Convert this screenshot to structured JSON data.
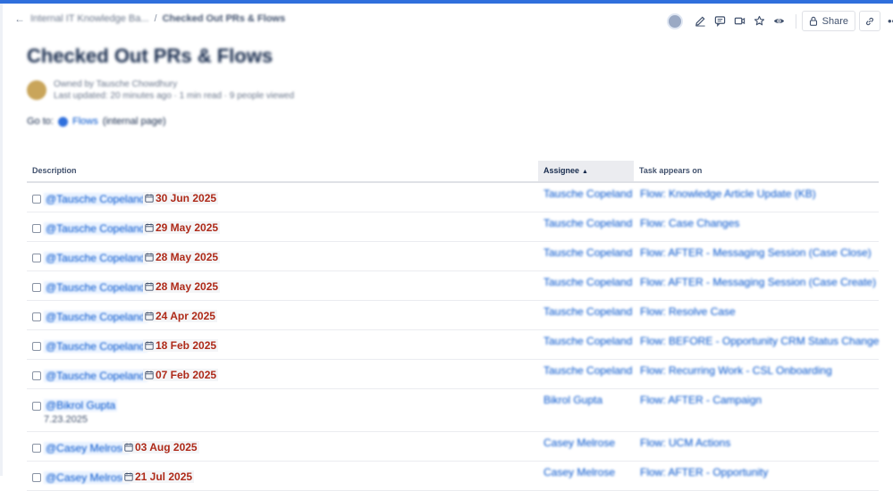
{
  "header": {
    "breadcrumbs": [
      "Internal IT Knowledge Ba..."
    ],
    "current_page": "Checked Out PRs & Flows",
    "share_label": "Share"
  },
  "page": {
    "title": "Checked Out PRs & Flows",
    "owner_line": "Owned by Tausche Chowdhury",
    "meta_line": "Last updated: 20 minutes ago · 1 min read · 9 people viewed",
    "goto_prefix": "Go to:",
    "goto_link": "Flows",
    "goto_suffix": "(internal page)"
  },
  "table": {
    "headers": {
      "description": "Description",
      "assignee": "Assignee",
      "task": "Task appears on"
    },
    "rows": [
      {
        "mention": "@Tausche Copeland",
        "date": "30 Jun 2025",
        "assignee": "Tausche Copeland",
        "task": "Flow: Knowledge Article Update (KB)"
      },
      {
        "mention": "@Tausche Copeland",
        "date": "29 May 2025",
        "assignee": "Tausche Copeland",
        "task": "Flow: Case Changes"
      },
      {
        "mention": "@Tausche Copeland",
        "date": "28 May 2025",
        "assignee": "Tausche Copeland",
        "task": "Flow: AFTER - Messaging Session (Case Close)"
      },
      {
        "mention": "@Tausche Copeland",
        "date": "28 May 2025",
        "assignee": "Tausche Copeland",
        "task": "Flow: AFTER - Messaging Session (Case Create)"
      },
      {
        "mention": "@Tausche Copeland",
        "date": "24 Apr 2025",
        "assignee": "Tausche Copeland",
        "task": "Flow: Resolve Case"
      },
      {
        "mention": "@Tausche Copeland",
        "date": "18 Feb 2025",
        "assignee": "Tausche Copeland",
        "task": "Flow: BEFORE - Opportunity CRM Status Change"
      },
      {
        "mention": "@Tausche Copeland",
        "date": "07 Feb 2025",
        "assignee": "Tausche Copeland",
        "task": "Flow: Recurring Work - CSL Onboarding"
      },
      {
        "mention": "@Bikrol Gupta",
        "note": "7.23.2025",
        "assignee": "Bikrol Gupta",
        "task": "Flow: AFTER - Campaign"
      },
      {
        "mention": "@Casey Melrose",
        "date": "03 Aug 2025",
        "assignee": "Casey Melrose",
        "task": "Flow: UCM Actions"
      },
      {
        "mention": "@Casey Melrose",
        "date": "21 Jul 2025",
        "assignee": "Casey Melrose",
        "task": "Flow: AFTER - Opportunity"
      }
    ]
  }
}
